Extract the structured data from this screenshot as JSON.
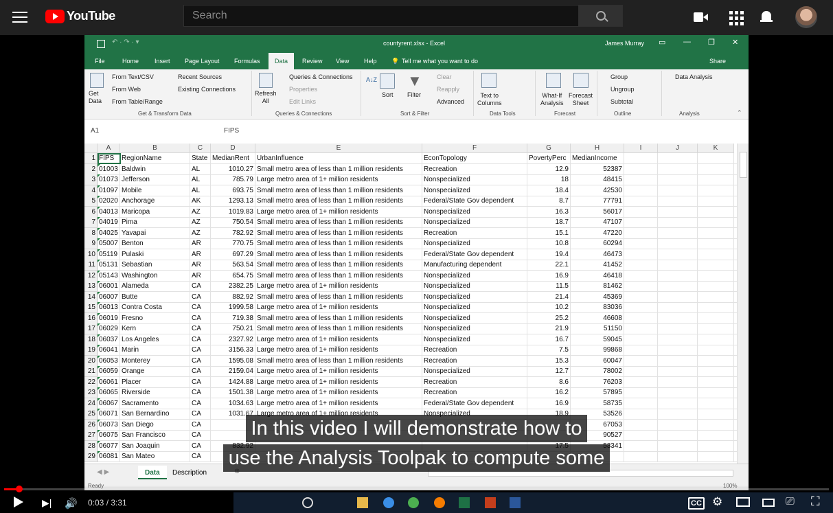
{
  "youtube": {
    "logo_text": "YouTube",
    "search_placeholder": "Search"
  },
  "excel": {
    "filename": "countyrent.xlsx  -  Excel",
    "user": "James Murray",
    "tabs": [
      "File",
      "Home",
      "Insert",
      "Page Layout",
      "Formulas",
      "Data",
      "Review",
      "View",
      "Help"
    ],
    "active_tab": "Data",
    "tell_me": "Tell me what you want to do",
    "share": "Share",
    "ribbon": {
      "get_data": "Get\nData",
      "from_text": "From Text/CSV",
      "from_web": "From Web",
      "from_table": "From Table/Range",
      "recent": "Recent Sources",
      "existing": "Existing Connections",
      "refresh": "Refresh\nAll",
      "queries": "Queries & Connections",
      "properties": "Properties",
      "edit_links": "Edit Links",
      "sort": "Sort",
      "filter": "Filter",
      "clear": "Clear",
      "reapply": "Reapply",
      "advanced": "Advanced",
      "text_to_columns": "Text to\nColumns",
      "whatif": "What-If\nAnalysis",
      "forecast": "Forecast\nSheet",
      "group": "Group",
      "ungroup": "Ungroup",
      "subtotal": "Subtotal",
      "data_analysis": "Data Analysis",
      "groups": [
        "Get & Transform Data",
        "Queries & Connections",
        "Sort & Filter",
        "Data Tools",
        "Forecast",
        "Outline",
        "Analysis"
      ]
    },
    "name_box": "A1",
    "formula": "FIPS",
    "columns": [
      "A",
      "B",
      "C",
      "D",
      "E",
      "F",
      "G",
      "H",
      "I",
      "J",
      "K"
    ],
    "header": [
      "FIPS",
      "RegionName",
      "State",
      "MedianRent",
      "UrbanInfluence",
      "EconTopology",
      "PovertyPerc",
      "MedianIncome"
    ],
    "rows": [
      [
        "01003",
        "Baldwin",
        "AL",
        "1010.27",
        "Small metro area of less than 1 million residents",
        "Recreation",
        "12.9",
        "52387"
      ],
      [
        "01073",
        "Jefferson",
        "AL",
        "785.79",
        "Large metro area of 1+ million residents",
        "Nonspecialized",
        "18",
        "48415"
      ],
      [
        "01097",
        "Mobile",
        "AL",
        "693.75",
        "Small metro area of less than 1 million residents",
        "Nonspecialized",
        "18.4",
        "42530"
      ],
      [
        "02020",
        "Anchorage",
        "AK",
        "1293.13",
        "Small metro area of less than 1 million residents",
        "Federal/State Gov dependent",
        "8.7",
        "77791"
      ],
      [
        "04013",
        "Maricopa",
        "AZ",
        "1019.83",
        "Large metro area of 1+ million residents",
        "Nonspecialized",
        "16.3",
        "56017"
      ],
      [
        "04019",
        "Pima",
        "AZ",
        "750.54",
        "Small metro area of less than 1 million residents",
        "Nonspecialized",
        "18.7",
        "47107"
      ],
      [
        "04025",
        "Yavapai",
        "AZ",
        "782.92",
        "Small metro area of less than 1 million residents",
        "Recreation",
        "15.1",
        "47220"
      ],
      [
        "05007",
        "Benton",
        "AR",
        "770.75",
        "Small metro area of less than 1 million residents",
        "Nonspecialized",
        "10.8",
        "60294"
      ],
      [
        "05119",
        "Pulaski",
        "AR",
        "697.29",
        "Small metro area of less than 1 million residents",
        "Federal/State Gov dependent",
        "19.4",
        "46473"
      ],
      [
        "05131",
        "Sebastian",
        "AR",
        "563.54",
        "Small metro area of less than 1 million residents",
        "Manufacturing dependent",
        "22.1",
        "41452"
      ],
      [
        "05143",
        "Washington",
        "AR",
        "654.75",
        "Small metro area of less than 1 million residents",
        "Nonspecialized",
        "16.9",
        "46418"
      ],
      [
        "06001",
        "Alameda",
        "CA",
        "2382.25",
        "Large metro area of 1+ million residents",
        "Nonspecialized",
        "11.5",
        "81462"
      ],
      [
        "06007",
        "Butte",
        "CA",
        "882.92",
        "Small metro area of less than 1 million residents",
        "Nonspecialized",
        "21.4",
        "45369"
      ],
      [
        "06013",
        "Contra Costa",
        "CA",
        "1999.58",
        "Large metro area of 1+ million residents",
        "Nonspecialized",
        "10.2",
        "83036"
      ],
      [
        "06019",
        "Fresno",
        "CA",
        "719.38",
        "Small metro area of less than 1 million residents",
        "Nonspecialized",
        "25.2",
        "46608"
      ],
      [
        "06029",
        "Kern",
        "CA",
        "750.21",
        "Small metro area of less than 1 million residents",
        "Nonspecialized",
        "21.9",
        "51150"
      ],
      [
        "06037",
        "Los Angeles",
        "CA",
        "2327.92",
        "Large metro area of 1+ million residents",
        "Nonspecialized",
        "16.7",
        "59045"
      ],
      [
        "06041",
        "Marin",
        "CA",
        "3156.33",
        "Large metro area of 1+ million residents",
        "Recreation",
        "7.5",
        "99868"
      ],
      [
        "06053",
        "Monterey",
        "CA",
        "1595.08",
        "Small metro area of less than 1 million residents",
        "Recreation",
        "15.3",
        "60047"
      ],
      [
        "06059",
        "Orange",
        "CA",
        "2159.04",
        "Large metro area of 1+ million residents",
        "Nonspecialized",
        "12.7",
        "78002"
      ],
      [
        "06061",
        "Placer",
        "CA",
        "1424.88",
        "Large metro area of 1+ million residents",
        "Recreation",
        "8.6",
        "76203"
      ],
      [
        "06065",
        "Riverside",
        "CA",
        "1501.38",
        "Large metro area of 1+ million residents",
        "Recreation",
        "16.2",
        "57895"
      ],
      [
        "06067",
        "Sacramento",
        "CA",
        "1034.63",
        "Large metro area of 1+ million residents",
        "Federal/State Gov dependent",
        "16.9",
        "58735"
      ],
      [
        "06071",
        "San Bernardino",
        "CA",
        "1031.67",
        "Large metro area of 1+ million residents",
        "Nonspecialized",
        "18.9",
        "53526"
      ],
      [
        "06073",
        "San Diego",
        "CA",
        "",
        "",
        "",
        "",
        "67053"
      ],
      [
        "06075",
        "San Francisco",
        "CA",
        "",
        "",
        "",
        "",
        "90527"
      ],
      [
        "06077",
        "San Joaquin",
        "CA",
        "832.92",
        "",
        "",
        "17.5",
        "53341"
      ],
      [
        "06081",
        "San Mateo",
        "CA",
        "",
        "",
        "",
        "",
        ""
      ]
    ],
    "sheets": [
      "Data",
      "Description"
    ],
    "status": "Ready",
    "zoom": "100%"
  },
  "caption": [
    "In this video I will demonstrate how to",
    "use the Analysis Toolpak to compute some"
  ],
  "player": {
    "time": "0:03 / 3:31",
    "progress": 0.0143
  }
}
